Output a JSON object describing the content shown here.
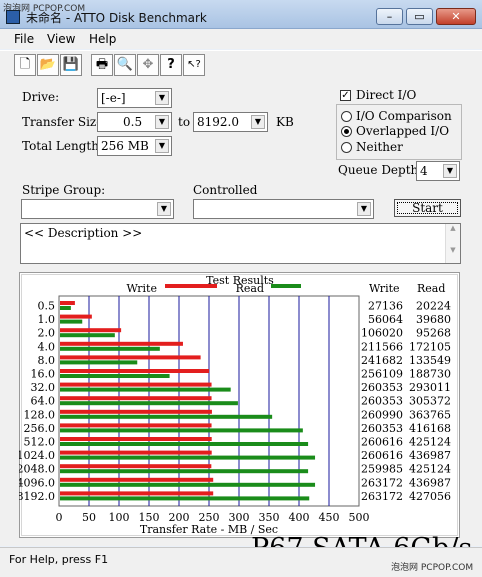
{
  "watermark": "泡泡网 PCPOP.COM",
  "window": {
    "title": "未命名 - ATTO Disk Benchmark",
    "controls": [
      "–",
      "▭",
      "✕"
    ]
  },
  "menu": [
    "File",
    "View",
    "Help"
  ],
  "toolbar": [
    {
      "icon": "new-document-icon",
      "glyph": "🗋"
    },
    {
      "icon": "open-folder-icon",
      "glyph": "📂"
    },
    {
      "icon": "save-icon",
      "glyph": "💾"
    },
    {
      "icon": "print-icon",
      "glyph": "🖶"
    },
    {
      "icon": "print-preview-icon",
      "glyph": "🔍"
    },
    {
      "icon": "move-icon",
      "glyph": "✥"
    },
    {
      "icon": "help-icon",
      "glyph": "?"
    },
    {
      "icon": "context-help-icon",
      "glyph": "↖?"
    }
  ],
  "form": {
    "drive_label": "Drive:",
    "drive_value": "[-e-]",
    "transfer_size_label": "Transfer Size:",
    "transfer_from": "0.5",
    "to_label": "to",
    "transfer_to": "8192.0",
    "kb_label": "KB",
    "total_length_label": "Total Length:",
    "total_length_value": "256 MB",
    "direct_io_label": "Direct I/O",
    "direct_io_checked": true,
    "io_comparison_label": "I/O Comparison",
    "overlapped_io_label": "Overlapped I/O",
    "neither_label": "Neither",
    "selected_mode": "Overlapped I/O",
    "queue_depth_label": "Queue Depth:",
    "queue_depth_value": "4",
    "stripe_group_label": "Stripe Group:",
    "stripe_group_value": "",
    "controlled_label": "Controlled",
    "controlled_value": "",
    "start_label": "Start",
    "description": "<< Description >>"
  },
  "results": {
    "title": "Test Results",
    "write_legend": "Write",
    "read_legend": "Read",
    "write_col": "Write",
    "read_col": "Read"
  },
  "chart_data": {
    "type": "bar",
    "orientation": "horizontal",
    "title": "Test Results",
    "xlabel": "Transfer Rate - MB / Sec",
    "xlim": [
      0,
      500
    ],
    "xticks": [
      0,
      50,
      100,
      150,
      200,
      250,
      300,
      350,
      400,
      450,
      500
    ],
    "categories": [
      "0.5",
      "1.0",
      "2.0",
      "4.0",
      "8.0",
      "16.0",
      "32.0",
      "64.0",
      "128.0",
      "256.0",
      "512.0",
      "1024.0",
      "2048.0",
      "4096.0",
      "8192.0"
    ],
    "series": [
      {
        "name": "Write",
        "color": "#e31e1e",
        "values": [
          27136,
          56064,
          106020,
          211566,
          241682,
          256109,
          260353,
          260353,
          260990,
          260353,
          260616,
          260616,
          259985,
          263172,
          263172
        ]
      },
      {
        "name": "Read",
        "color": "#1a8c1a",
        "values": [
          20224,
          39680,
          95268,
          172105,
          133549,
          188730,
          293011,
          305372,
          363765,
          416168,
          425124,
          436987,
          425124,
          436987,
          427056
        ]
      }
    ],
    "value_units": "KB/s",
    "grid": true,
    "legend": "top"
  },
  "status_text": "For Help, press F1",
  "overlay_caption": "P67 SATA 6Gb/s",
  "bottom_watermark": "泡泡网 PCPOP.COM"
}
